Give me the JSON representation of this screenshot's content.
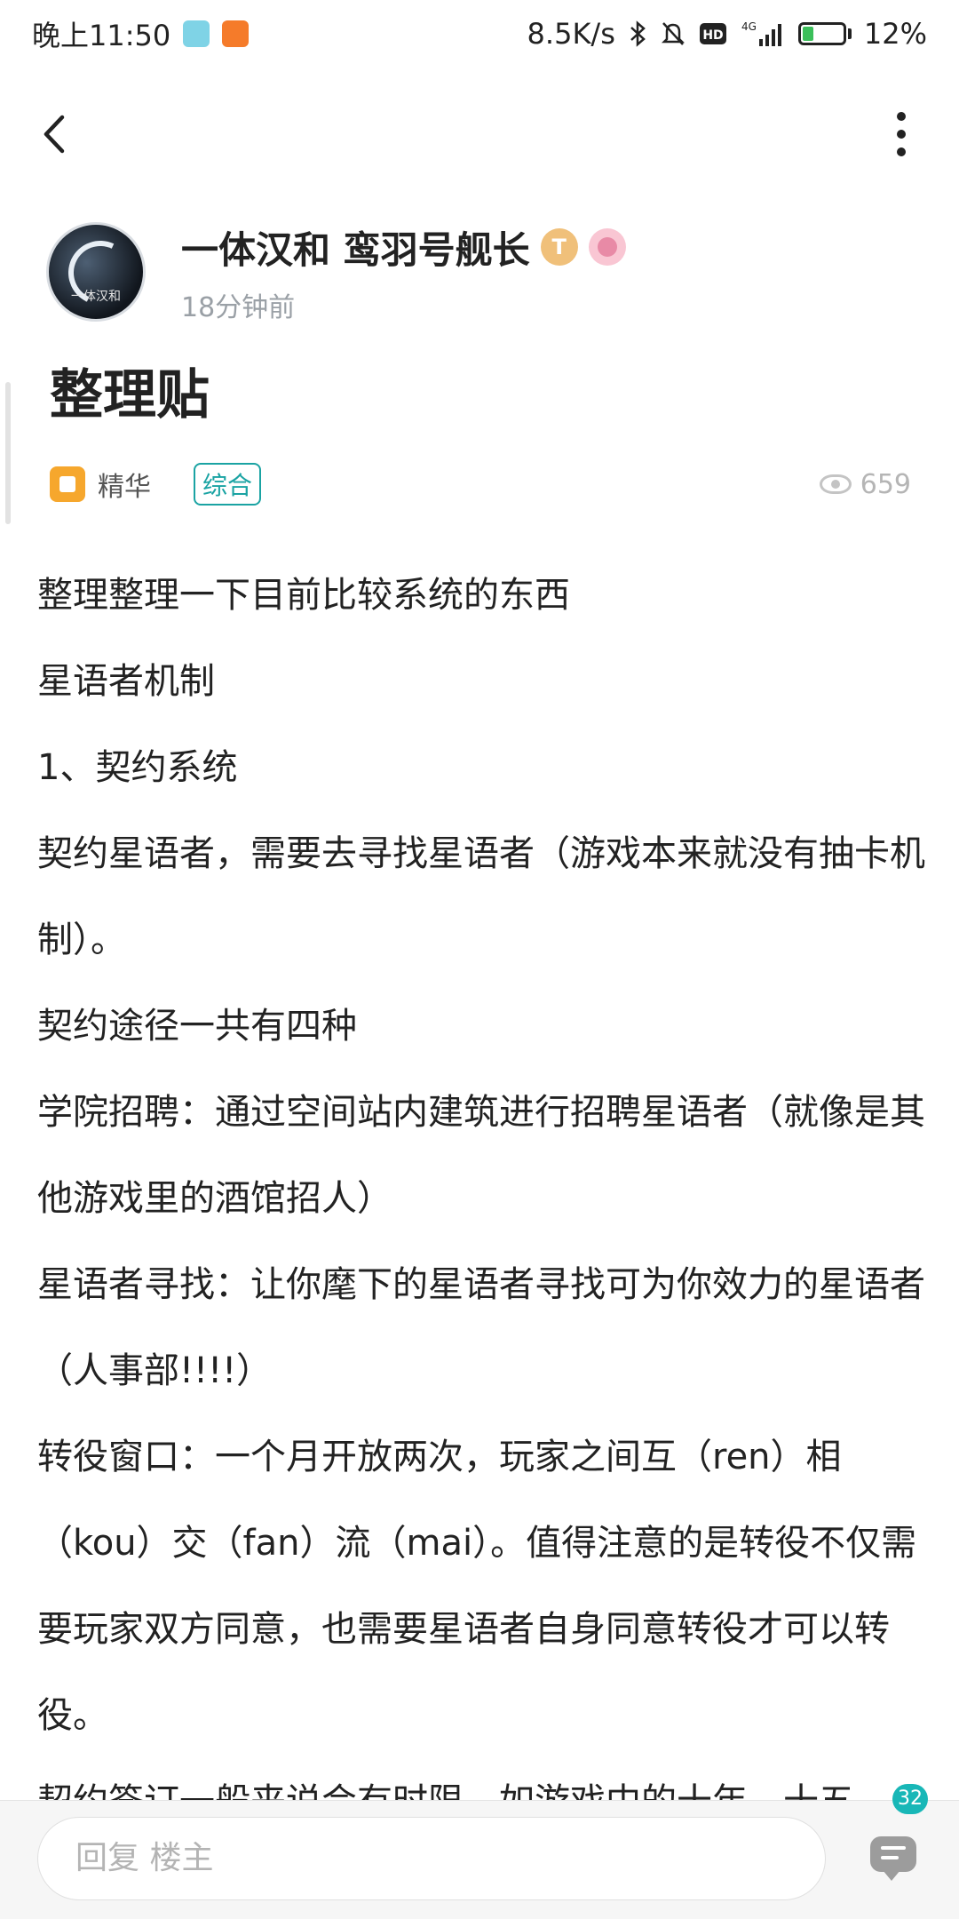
{
  "status_bar": {
    "time": "晚上11:50",
    "network_speed": "8.5K/s",
    "hd_label": "HD",
    "signal_label": "4G",
    "battery_percent": "12%",
    "icons": [
      "app-notification-icon",
      "mi-icon",
      "bluetooth-icon",
      "mute-icon",
      "hd-icon",
      "signal-icon",
      "battery-icon"
    ]
  },
  "nav": {
    "back_icon": "chevron-left-icon",
    "more_icon": "more-vertical-icon"
  },
  "author": {
    "name": "一体汉和 鸾羽号舰长",
    "avatar_text": "一体汉和",
    "time_ago": "18分钟前",
    "badges": [
      "t-badge-icon",
      "pink-badge-icon"
    ],
    "badge_t_label": "T"
  },
  "post": {
    "title": "整理贴",
    "essence_label": "精华",
    "category_tag": "综合",
    "views": "659",
    "paragraphs": [
      "整理整理一下目前比较系统的东西",
      "星语者机制",
      "1、契约系统",
      "契约星语者，需要去寻找星语者（游戏本来就没有抽卡机制）。",
      "契约途径一共有四种",
      "学院招聘：通过空间站内建筑进行招聘星语者（就像是其他游戏里的酒馆招人）",
      "星语者寻找：让你麾下的星语者寻找可为你效力的星语者（人事部!!!!）",
      "转役窗口：一个月开放两次，玩家之间互（ren）相（kou）交（fan）流（mai）。值得注意的是转役不仅需要玩家双方同意，也需要星语者自身同意转役才可以转役。",
      "契约签订一般来说会有时限，如游戏中的十年、十五"
    ]
  },
  "bottom_bar": {
    "reply_placeholder": "回复  楼主",
    "comment_count": "32",
    "comment_icon": "comment-icon"
  }
}
